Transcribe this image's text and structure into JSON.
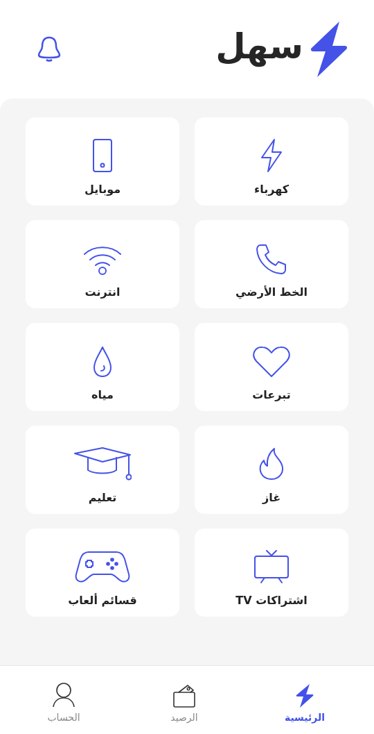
{
  "header": {
    "logo_text": "سهل"
  },
  "services": [
    {
      "kind": "electricity",
      "label": "كهرباء"
    },
    {
      "kind": "mobile",
      "label": "موبايل"
    },
    {
      "kind": "landline",
      "label": "الخط الأرضي"
    },
    {
      "kind": "internet",
      "label": "انترنت"
    },
    {
      "kind": "donations",
      "label": "تبرعات"
    },
    {
      "kind": "water",
      "label": "مياه"
    },
    {
      "kind": "gas",
      "label": "غاز"
    },
    {
      "kind": "education",
      "label": "تعليم"
    },
    {
      "kind": "tv",
      "label": "اشتراكات TV"
    },
    {
      "kind": "games",
      "label": "قسائم ألعاب"
    }
  ],
  "bottom_nav": [
    {
      "kind": "home",
      "label": "الرئيسية",
      "selected": true
    },
    {
      "kind": "balance",
      "label": "الرصيد",
      "selected": false
    },
    {
      "kind": "account",
      "label": "الحساب",
      "selected": false
    }
  ]
}
